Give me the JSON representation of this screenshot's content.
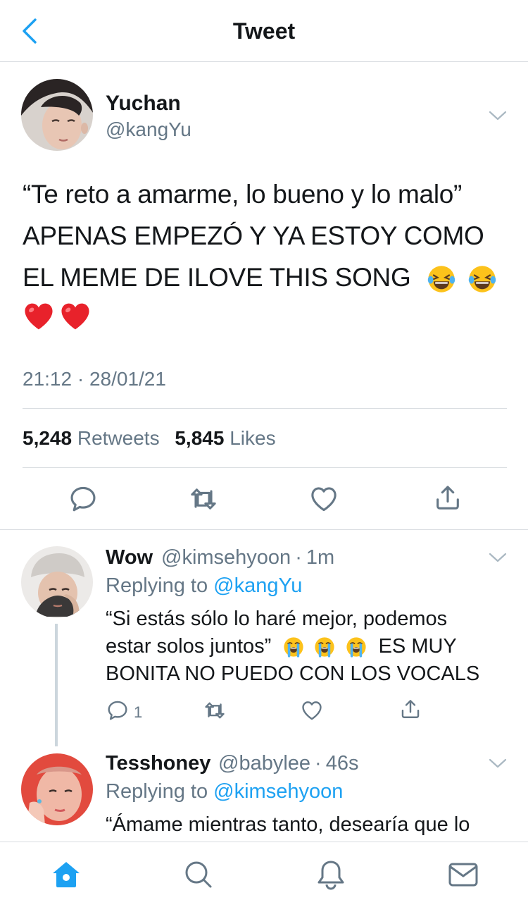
{
  "header": {
    "title": "Tweet"
  },
  "tweet": {
    "name": "Yuchan",
    "handle": "@kangYu",
    "text_line1": "“Te reto a amarme, lo bueno y lo malo”",
    "text_line2": "APENAS EMPEZÓ Y YA ESTOY COMO",
    "text_line3": "EL MEME DE ILOVE THIS SONG",
    "emoji_line3": [
      "😂",
      "😂"
    ],
    "emoji_line4": [
      "❤️",
      "❤️"
    ],
    "timestamp": "21:12 · 28/01/21",
    "retweets_count": "5,248",
    "retweets_label": "Retweets",
    "likes_count": "5,845",
    "likes_label": "Likes"
  },
  "replies": [
    {
      "name": "Wow",
      "handle": "@kimsehyoon",
      "time": "1m",
      "replying_label": "Replying to",
      "replying_to": "@kangYu",
      "line1": "“Si estás sólo lo haré mejor, podemos",
      "line2_a": "estar solos juntos”",
      "emoji": [
        "😭",
        "😭",
        "😭"
      ],
      "line2_b": "ES MUY",
      "line3": "BONITA NO PUEDO CON LOS VOCALS",
      "reply_count": "1"
    },
    {
      "name": "Tesshoney",
      "handle": "@babylee",
      "time": "46s",
      "replying_label": "Replying to",
      "replying_to": "@kimsehyoon",
      "line1": "“Ámame mientras tanto, desearía que lo"
    }
  ],
  "icons": {
    "back": "chevron-left-icon",
    "caret": "chevron-down-icon",
    "reply": "comment-icon",
    "retweet": "retweet-icon",
    "like": "heart-icon",
    "share": "share-icon",
    "home": "home-icon",
    "search": "search-icon",
    "notifications": "bell-icon",
    "messages": "mail-icon"
  },
  "colors": {
    "accent": "#1da1f2",
    "text": "#14171a",
    "secondary": "#657786",
    "divider": "#d9dde1",
    "icon_gray": "#657786"
  }
}
